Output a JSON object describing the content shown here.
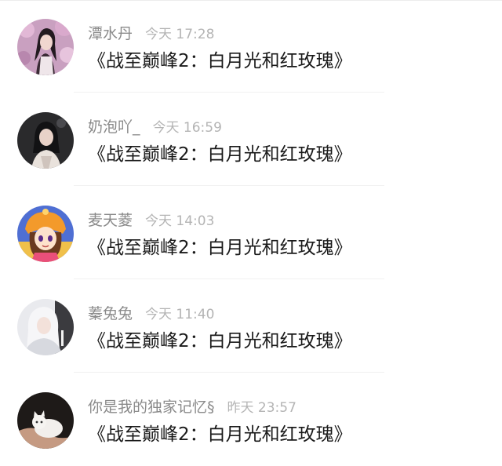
{
  "comments": [
    {
      "username": "潭水丹",
      "time": "今天 17:28",
      "message": "《战至巅峰2：白月光和红玫瑰》",
      "avatar": "avatar-girl-pink-blossom"
    },
    {
      "username": "奶泡吖_",
      "time": "今天 16:59",
      "message": "《战至巅峰2：白月光和红玫瑰》",
      "avatar": "avatar-girl-dark-portrait"
    },
    {
      "username": "麦天菱",
      "time": "今天 14:03",
      "message": "《战至巅峰2：白月光和红玫瑰》",
      "avatar": "avatar-anime-girl-orange-hat"
    },
    {
      "username": "蓁兔兔",
      "time": "今天 11:40",
      "message": "《战至巅峰2：白月光和红玫瑰》",
      "avatar": "avatar-girl-white-hair"
    },
    {
      "username": "你是我的独家记忆§",
      "time": "昨天 23:57",
      "message": "《战至巅峰2：白月光和红玫瑰》",
      "avatar": "avatar-white-cat"
    }
  ],
  "colors": {
    "username": "#8a8a8a",
    "time": "#b4b4b4",
    "message": "#1a1a1a",
    "divider": "#f1f1f1"
  }
}
